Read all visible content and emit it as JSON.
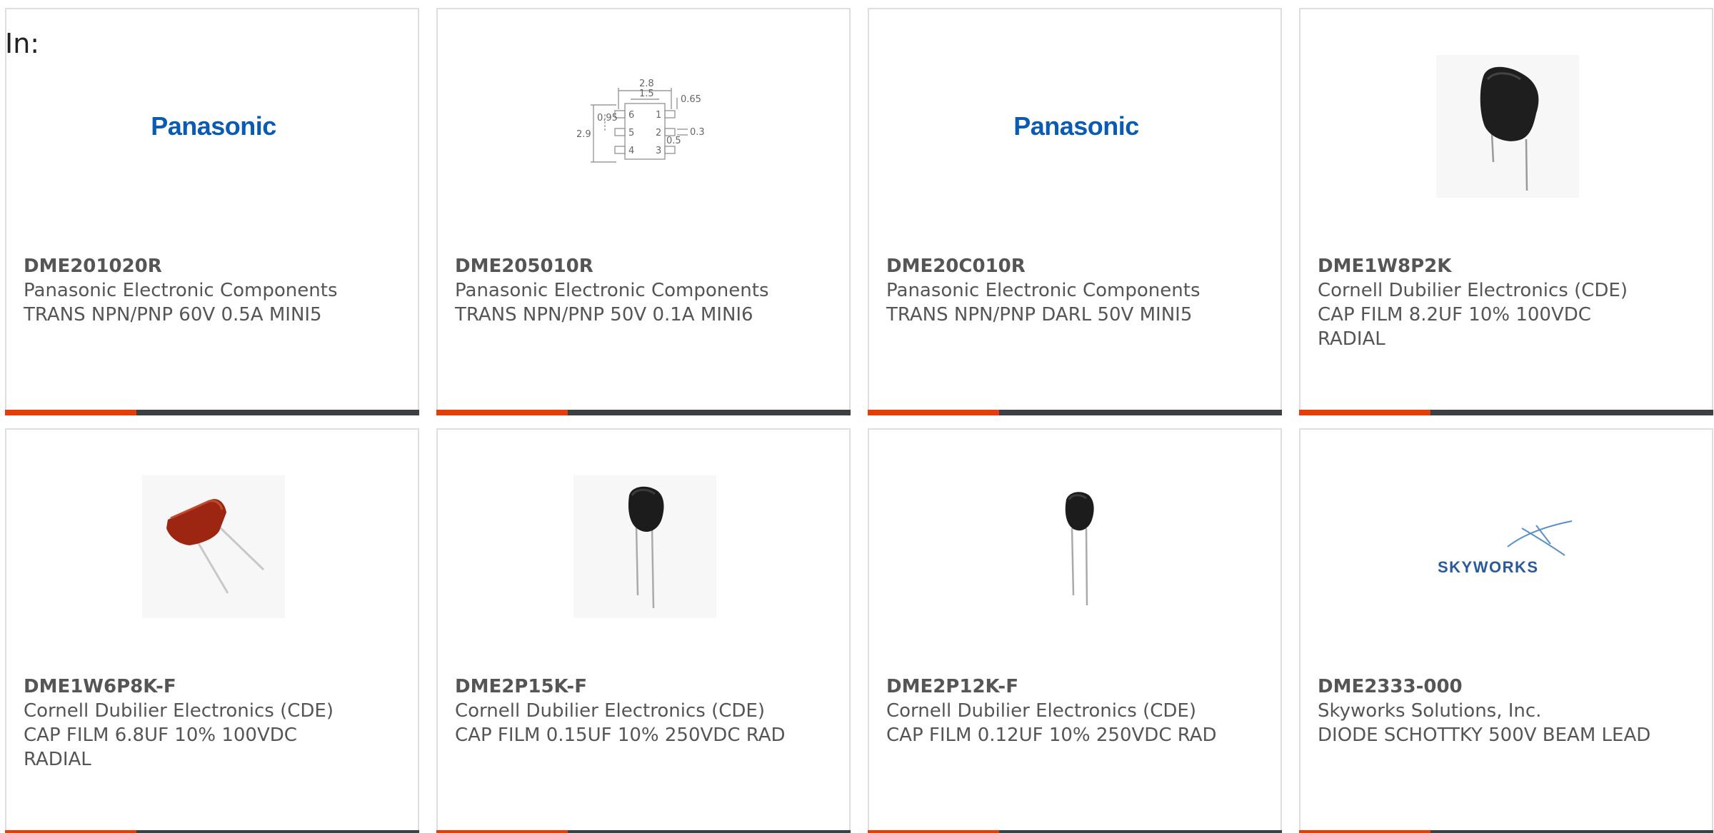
{
  "header": {
    "in_label": "In:"
  },
  "colors": {
    "accent": "#e23e0c",
    "bar": "#3d4043",
    "panasonic_blue": "#0a5bb3",
    "skyworks_blue": "#2a5a9a"
  },
  "products": [
    {
      "part_number": "DME201020R",
      "manufacturer": "Panasonic Electronic Components",
      "description": "TRANS NPN/PNP 60V 0.5A MINI5",
      "image": "panasonic-logo",
      "logo_text": "Panasonic"
    },
    {
      "part_number": "DME205010R",
      "manufacturer": "Panasonic Electronic Components",
      "description": "TRANS NPN/PNP 50V 0.1A MINI6",
      "image": "package-drawing",
      "drawing_labels": [
        "2.8",
        "1.5",
        "0.65",
        "0.95",
        "2.9",
        "0.3",
        "0.5",
        "1",
        "2",
        "3",
        "4",
        "5",
        "6"
      ]
    },
    {
      "part_number": "DME20C010R",
      "manufacturer": "Panasonic Electronic Components",
      "description": "TRANS NPN/PNP DARL 50V MINI5",
      "image": "panasonic-logo",
      "logo_text": "Panasonic"
    },
    {
      "part_number": "DME1W8P2K",
      "manufacturer": "Cornell Dubilier Electronics (CDE)",
      "description": "CAP FILM 8.2UF 10% 100VDC RADIAL",
      "image": "black-film-capacitor-large"
    },
    {
      "part_number": "DME1W6P8K-F",
      "manufacturer": "Cornell Dubilier Electronics (CDE)",
      "description": "CAP FILM 6.8UF 10% 100VDC RADIAL",
      "image": "red-film-capacitor"
    },
    {
      "part_number": "DME2P15K-F",
      "manufacturer": "Cornell Dubilier Electronics (CDE)",
      "description": "CAP FILM 0.15UF 10% 250VDC RAD",
      "image": "black-film-capacitor-small"
    },
    {
      "part_number": "DME2P12K-F",
      "manufacturer": "Cornell Dubilier Electronics (CDE)",
      "description": "CAP FILM 0.12UF 10% 250VDC RAD",
      "image": "black-film-capacitor-small"
    },
    {
      "part_number": "DME2333-000",
      "manufacturer": "Skyworks Solutions, Inc.",
      "description": "DIODE SCHOTTKY 500V BEAM LEAD",
      "image": "skyworks-logo",
      "logo_text": "SKYWORKS"
    }
  ]
}
